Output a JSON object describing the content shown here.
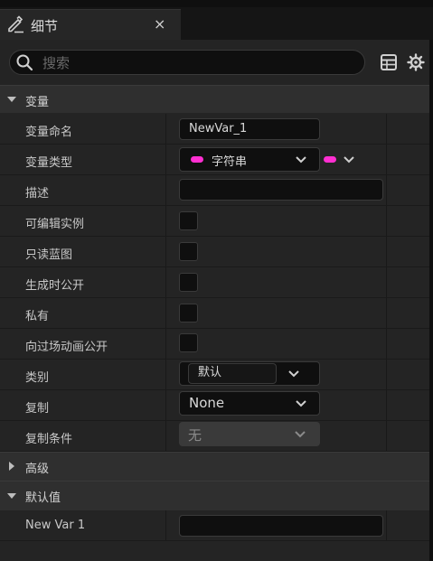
{
  "tab": {
    "title": "细节",
    "close": "×"
  },
  "search": {
    "placeholder": "搜索"
  },
  "sections": {
    "variable": "变量",
    "advanced": "高级",
    "default_value": "默认值"
  },
  "rows": {
    "var_name": {
      "label": "变量命名",
      "value": "NewVar_1"
    },
    "var_type": {
      "label": "变量类型",
      "value": "字符串"
    },
    "description": {
      "label": "描述",
      "value": ""
    },
    "instance_editable": {
      "label": "可编辑实例",
      "checked": false
    },
    "blueprint_readonly": {
      "label": "只读蓝图",
      "checked": false
    },
    "expose_on_spawn": {
      "label": "生成时公开",
      "checked": false
    },
    "private": {
      "label": "私有",
      "checked": false
    },
    "expose_cinematics": {
      "label": "向过场动画公开",
      "checked": false
    },
    "category": {
      "label": "类别",
      "value": "默认"
    },
    "replication": {
      "label": "复制",
      "value": "None"
    },
    "replication_condition": {
      "label": "复制条件",
      "value": "无"
    },
    "default_var": {
      "label": "New Var 1",
      "value": ""
    }
  },
  "colors": {
    "string_pin": "#ff2fd1",
    "panel": "#242424",
    "field": "#0f0f0f"
  },
  "icons": [
    "edit-icon",
    "close-icon",
    "search-icon",
    "table-icon",
    "gear-icon",
    "chevron-down-icon",
    "chevron-right-icon"
  ]
}
